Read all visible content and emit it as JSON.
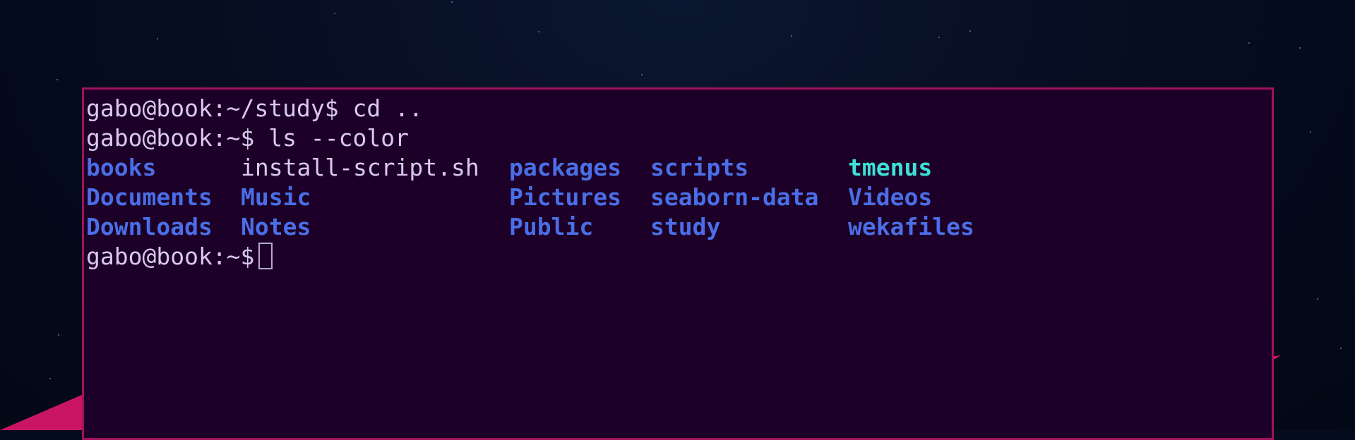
{
  "terminal": {
    "lines": [
      {
        "prompt": "gabo@book:~/study$",
        "command": "cd .."
      },
      {
        "prompt": "gabo@book:~$",
        "command": "ls --color"
      }
    ],
    "listing": {
      "rows": [
        [
          {
            "name": "books",
            "type": "dir"
          },
          {
            "name": "install-script.sh",
            "type": "file"
          },
          {
            "name": "packages",
            "type": "dir"
          },
          {
            "name": "scripts",
            "type": "dir"
          },
          {
            "name": "tmenus",
            "type": "exec"
          }
        ],
        [
          {
            "name": "Documents",
            "type": "dir"
          },
          {
            "name": "Music",
            "type": "dir"
          },
          {
            "name": "Pictures",
            "type": "dir"
          },
          {
            "name": "seaborn-data",
            "type": "dir"
          },
          {
            "name": "Videos",
            "type": "dir"
          }
        ],
        [
          {
            "name": "Downloads",
            "type": "dir"
          },
          {
            "name": "Notes",
            "type": "dir"
          },
          {
            "name": "Public",
            "type": "dir"
          },
          {
            "name": "study",
            "type": "dir"
          },
          {
            "name": "wekafiles",
            "type": "dir"
          }
        ]
      ]
    },
    "current_prompt": "gabo@book:~$"
  },
  "colors": {
    "background": "#050c1f",
    "terminal_bg": "#1d0028",
    "terminal_border": "#a0135a",
    "text": "#d8c8ee",
    "directory": "#4a6ee6",
    "executable": "#3ee0d6",
    "accent": "#e0186a"
  }
}
